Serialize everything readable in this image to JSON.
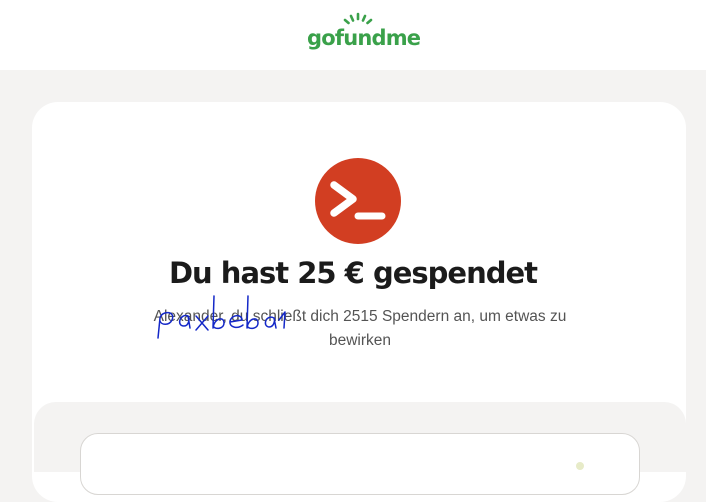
{
  "header": {
    "logo_text": "gofundme",
    "logo_icon": "sun-rays-icon",
    "brand_color": "#3aa14a"
  },
  "confirmation": {
    "app_icon": "terminal-icon",
    "app_icon_color": "#d23e22",
    "title": "Du hast 25 € gespendet",
    "subtitle": "Alexander, du schließt dich 2515 Spendern an, um etwas zu bewirken",
    "handwritten_overlay": "paxbeba1"
  }
}
